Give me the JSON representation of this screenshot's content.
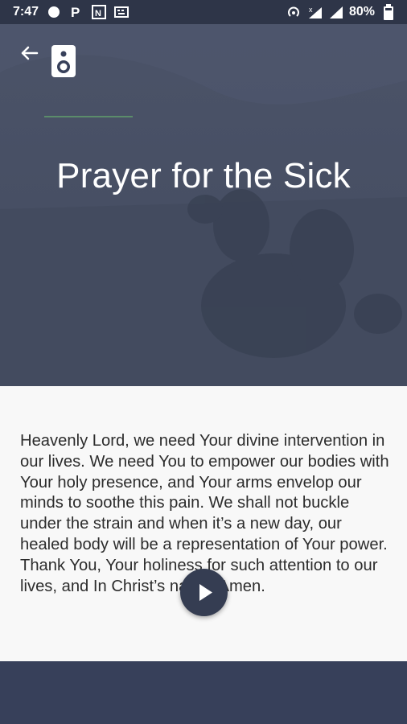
{
  "status_bar": {
    "time": "7:47",
    "battery": "80%",
    "icons": [
      "circle-icon",
      "parking-icon",
      "nfc-news-icon",
      "keyboard-icon",
      "hotspot-icon",
      "signal-x-icon",
      "signal-icon",
      "battery-icon"
    ]
  },
  "header": {
    "back_icon": "arrow-left-icon",
    "audio_icon": "speaker-icon",
    "title": "Prayer for the Sick"
  },
  "prayer": {
    "text": "Heavenly Lord, we need Your divine intervention in our lives. We need You to empower our bodies with Your holy presence, and Your arms envelop our minds to soothe this pain. We shall not buckle under the strain and when it’s a new day, our healed body will be a representation of Your power. Thank You, Your holiness for such attention to our lives, and In Christ’s name, Amen."
  },
  "player": {
    "icon": "play-icon"
  },
  "colors": {
    "status_bar": "#2e3548",
    "hero_overlay": "#454d62",
    "content_bg": "#f8f8f8",
    "footer_bg": "#37405a",
    "accent": "#5b8c6a",
    "play_button": "#353d52"
  }
}
